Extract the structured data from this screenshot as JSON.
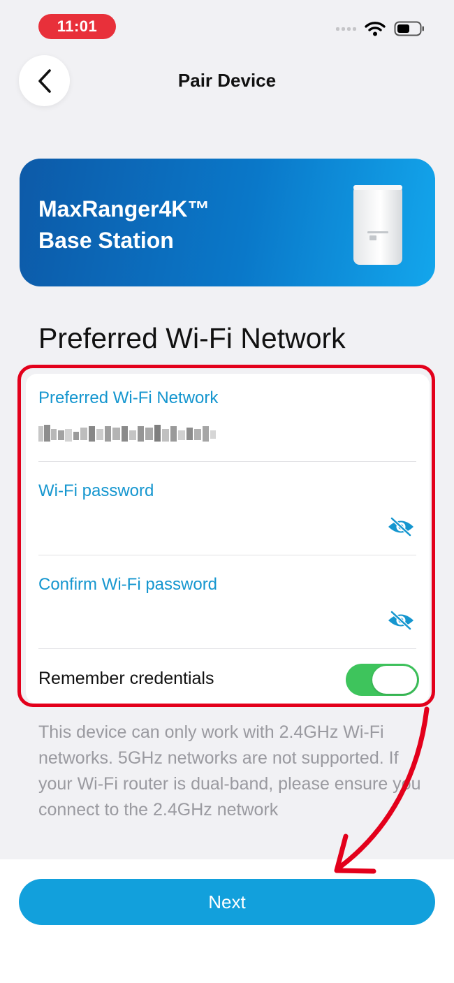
{
  "status_bar": {
    "time": "11:01",
    "wifi_icon": "wifi-icon",
    "battery_icon": "battery-icon",
    "time_pill_color": "#e8303a"
  },
  "header": {
    "title": "Pair Device",
    "back_icon": "chevron-left-icon"
  },
  "device_banner": {
    "line1": "MaxRanger4K™",
    "line2": "Base Station",
    "image": "base-station-device-image"
  },
  "section_heading": "Preferred Wi-Fi Network",
  "form": {
    "network_label": "Preferred Wi-Fi Network",
    "password_label": "Wi-Fi password",
    "password_value": "",
    "confirm_label": "Confirm Wi-Fi password",
    "confirm_value": "",
    "visibility_icon": "eye-slash-icon",
    "remember_label": "Remember credentials",
    "remember_on": true,
    "label_color": "#1596cf",
    "toggle_color": "#3ec45c"
  },
  "info_text": "This device can only work with 2.4GHz Wi-Fi networks. 5GHz networks are not supported. If your Wi-Fi router is dual-band, please ensure you connect to the 2.4GHz network",
  "next_button": {
    "label": "Next",
    "color": "#12a0dc"
  },
  "annotation": {
    "color": "#e3001b"
  }
}
